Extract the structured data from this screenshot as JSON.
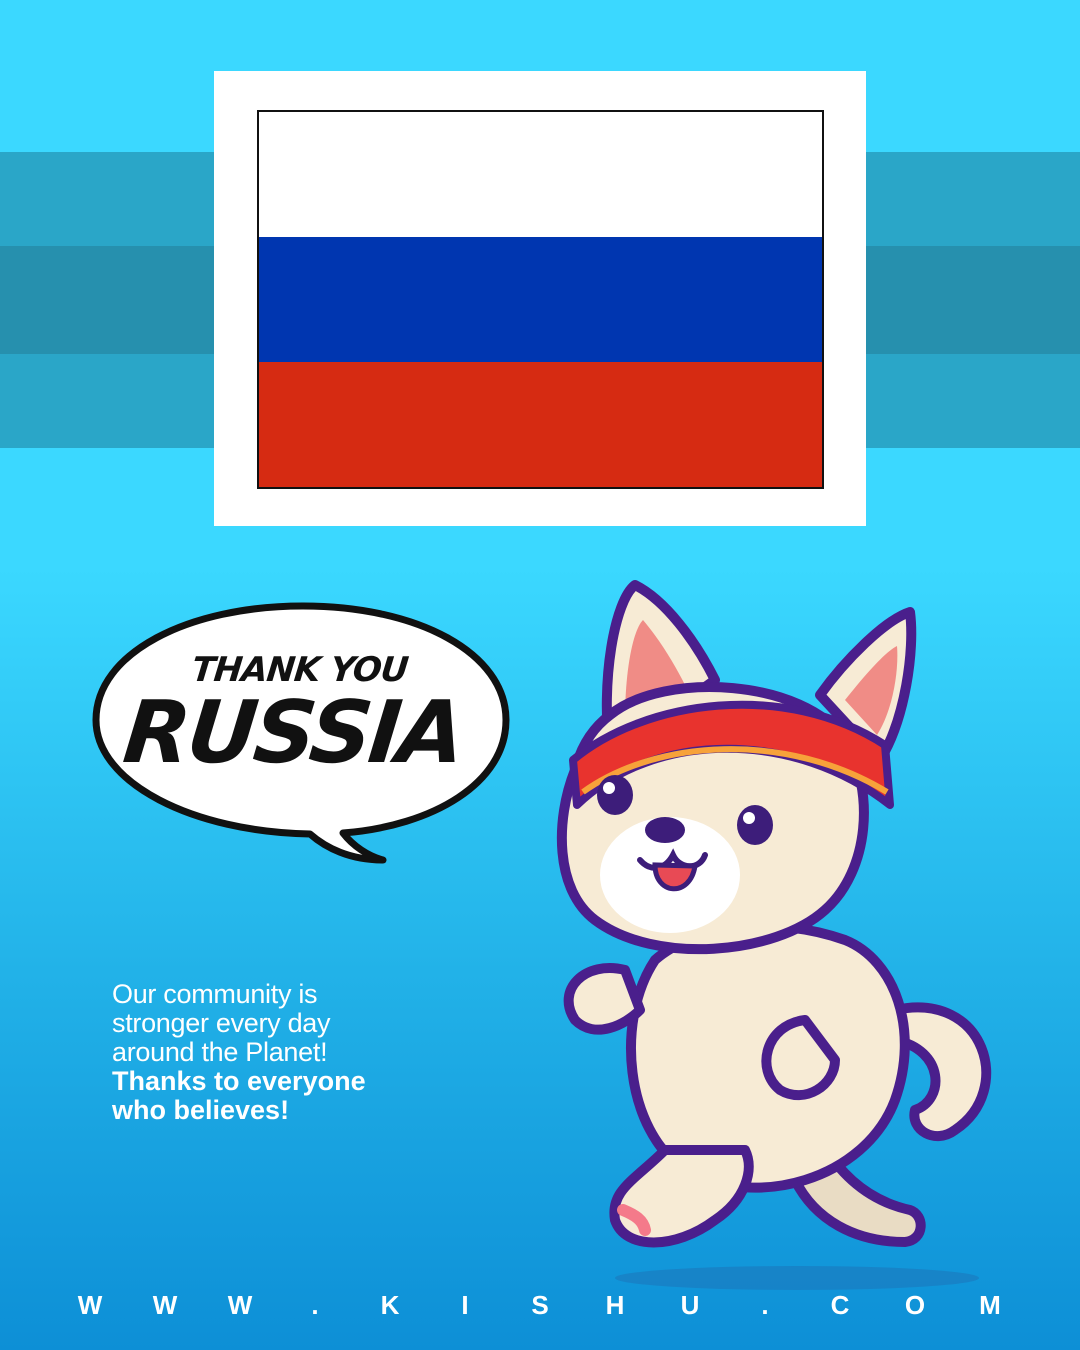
{
  "flag": {
    "colors": [
      "#ffffff",
      "#0036b0",
      "#d62b12"
    ],
    "icon": "russia-flag"
  },
  "speech_bubble": {
    "line1": "THANK YOU",
    "line2": "RUSSIA"
  },
  "message": {
    "light_lines": [
      "Our community is",
      "stronger every day",
      "around the Planet!"
    ],
    "strong_lines": [
      "Thanks to everyone",
      "who believes!"
    ]
  },
  "mascot": {
    "icon": "shiba-inu-running-mascot"
  },
  "website_letters": [
    "W",
    "W",
    "W",
    ".",
    "K",
    "I",
    "S",
    "H",
    "U",
    ".",
    "C",
    "O",
    "M"
  ],
  "colors": {
    "background_top": "#3bd8ff",
    "background_bottom": "#0d8fd6",
    "band_light": "#2aa6c8",
    "band_dark": "#2690ae"
  }
}
